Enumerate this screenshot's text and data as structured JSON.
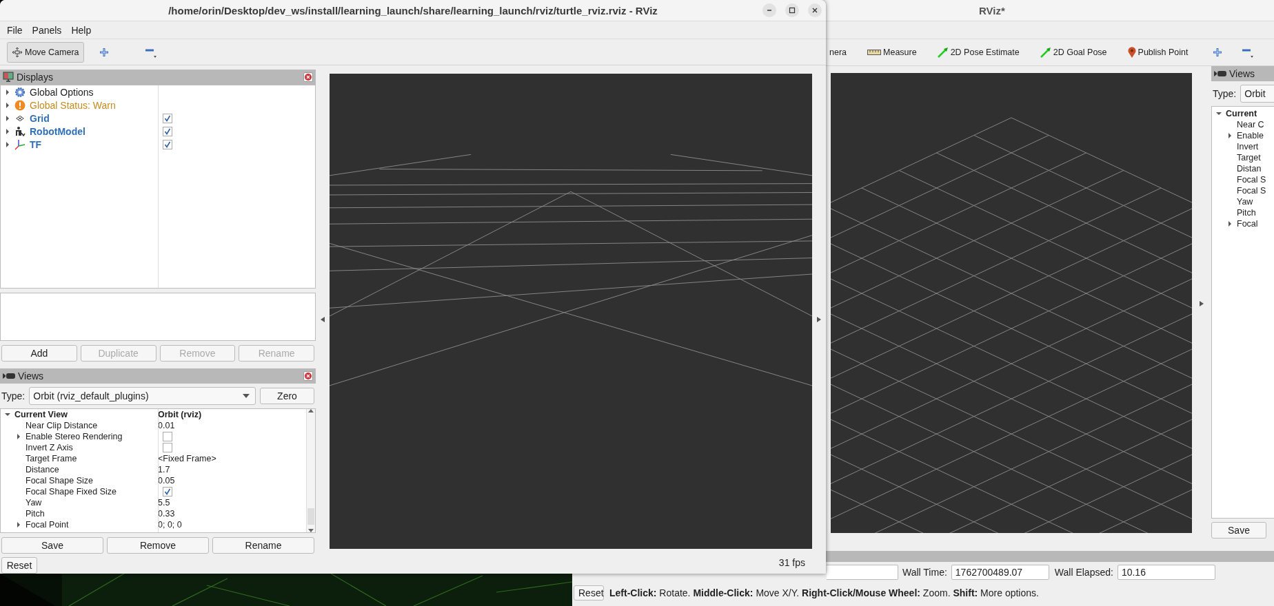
{
  "front_window": {
    "title": "/home/orin/Desktop/dev_ws/install/learning_launch/share/learning_launch/rviz/turtle_rviz.rviz - RViz",
    "menu": [
      "File",
      "Panels",
      "Help"
    ],
    "tools": [
      {
        "kind": "move_camera",
        "label": "Move Camera",
        "selected": true
      }
    ],
    "displays": {
      "title": "Displays",
      "items": [
        {
          "kind": "options",
          "label": "Global Options",
          "expanded": false
        },
        {
          "kind": "status",
          "label": "Global Status: Warn",
          "expanded": false
        },
        {
          "kind": "grid",
          "label": "Grid",
          "expanded": false,
          "checked": true
        },
        {
          "kind": "robot",
          "label": "RobotModel",
          "expanded": false,
          "checked": true
        },
        {
          "kind": "tf",
          "label": "TF",
          "expanded": false,
          "checked": true
        }
      ],
      "buttons": [
        {
          "label": "Add",
          "disabled": false
        },
        {
          "label": "Duplicate",
          "disabled": true
        },
        {
          "label": "Remove",
          "disabled": true
        },
        {
          "label": "Rename",
          "disabled": true
        }
      ]
    },
    "views": {
      "title": "Views",
      "type_label": "Type:",
      "type_value": "Orbit (rviz_default_plugins)",
      "zero_button": "Zero",
      "tree": [
        {
          "label": "Current View",
          "value": "Orbit (rviz)",
          "expanded": true,
          "children": [
            {
              "kind": "text",
              "label": "Near Clip Distance",
              "value": "0.01"
            },
            {
              "kind": "checkbox",
              "label": "Enable Stereo Rendering",
              "checked": false,
              "expanded": false
            },
            {
              "kind": "checkbox",
              "label": "Invert Z Axis",
              "checked": false
            },
            {
              "kind": "text",
              "label": "Target Frame",
              "value": "<Fixed Frame>"
            },
            {
              "kind": "text",
              "label": "Distance",
              "value": "1.7"
            },
            {
              "kind": "text",
              "label": "Focal Shape Size",
              "value": "0.05"
            },
            {
              "kind": "checkbox",
              "label": "Focal Shape Fixed Size",
              "checked": true
            },
            {
              "kind": "text",
              "label": "Yaw",
              "value": "5.5"
            },
            {
              "kind": "text",
              "label": "Pitch",
              "value": "0.33"
            },
            {
              "kind": "text",
              "label": "Focal Point",
              "value": "0; 0; 0",
              "expanded": false
            }
          ]
        }
      ],
      "buttons": [
        "Save",
        "Remove",
        "Rename"
      ],
      "reset_button": "Reset"
    },
    "fps": "31 fps"
  },
  "back_window": {
    "title": "RViz*",
    "tools": [
      {
        "kind": "camera",
        "label": "nera"
      },
      {
        "kind": "measure",
        "label": "Measure"
      },
      {
        "kind": "pose",
        "label": "2D Pose Estimate"
      },
      {
        "kind": "goal",
        "label": "2D Goal Pose"
      },
      {
        "kind": "point",
        "label": "Publish Point"
      }
    ],
    "views": {
      "title": "Views",
      "type_label": "Type:",
      "type_value": "Orbit",
      "tree": [
        {
          "label": "Current",
          "expanded": true,
          "children": [
            {
              "label": "Near C"
            },
            {
              "label": "Enable",
              "expanded": false
            },
            {
              "label": "Invert"
            },
            {
              "label": "Target"
            },
            {
              "label": "Distan"
            },
            {
              "label": "Focal S"
            },
            {
              "label": "Focal S"
            },
            {
              "label": "Yaw"
            },
            {
              "label": "Pitch"
            },
            {
              "label": "Focal",
              "expanded": false
            }
          ]
        }
      ],
      "save_button": "Save"
    },
    "time": [
      {
        "label": "Wall Time:",
        "value": "1762700489.07"
      },
      {
        "label": "Wall Elapsed:",
        "value": "10.16"
      }
    ],
    "reset_button": "Reset",
    "hint": "**Left-Click:** Rotate. **Middle-Click:** Move X/Y. **Right-Click/Mouse Wheel:** Zoom. **Shift:** More options."
  }
}
